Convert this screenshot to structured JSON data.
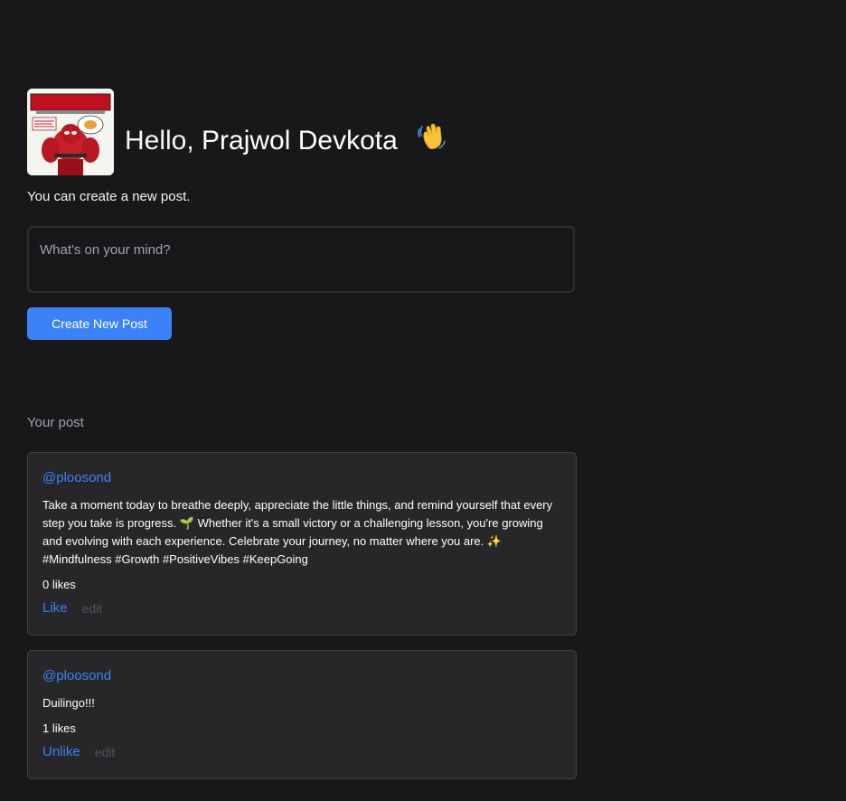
{
  "profile": {
    "greeting": "Hello,",
    "name": "Prajwol Devkota",
    "wave_icon": "waving-hand-icon",
    "avatar_logo_text": "DEADPOOL"
  },
  "composer": {
    "subtitle": "You can create a new post.",
    "placeholder": "What's on your mind?",
    "value": "",
    "button_label": "Create New Post"
  },
  "posts_section": {
    "title": "Your post"
  },
  "posts": [
    {
      "author": "@ploosond",
      "content_part1": "Take a moment today to breathe deeply, appreciate the little things, and remind yourself that every step you take is progress.",
      "emoji1": "🌱",
      "content_part2": "Whether it's a small victory or a challenging lesson, you're growing and evolving with each experience. Celebrate your journey, no matter where you are.",
      "emoji2": "✨",
      "content_part3": "#Mindfulness #Growth #PositiveVibes #KeepGoing",
      "likes": "0 likes",
      "like_label": "Like",
      "edit_label": "edit"
    },
    {
      "author": "@ploosond",
      "content": "Duilingo!!!",
      "likes": "1 likes",
      "like_label": "Unlike",
      "edit_label": "edit"
    }
  ],
  "colors": {
    "background": "#18181b",
    "card": "#27272a",
    "accent": "#3b82f6",
    "muted": "#a1a1aa"
  }
}
